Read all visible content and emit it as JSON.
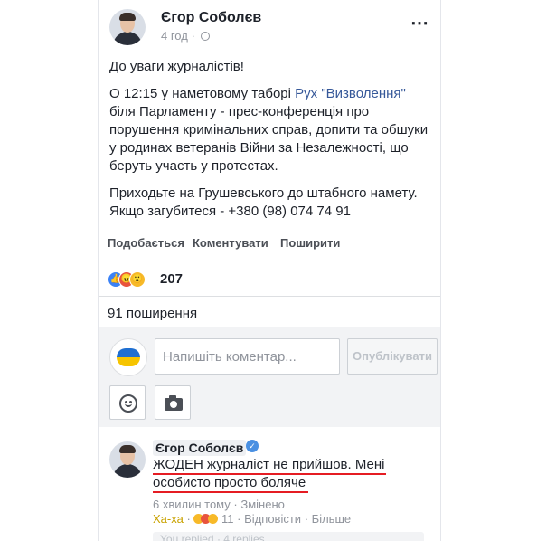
{
  "post": {
    "author": "Єгор Соболєв",
    "time": "4 год",
    "time_separator": "·",
    "paragraph1": "До уваги журналістів!",
    "paragraph2_before": "О 12:15 у наметовому таборі ",
    "paragraph2_link": "Рух \"Визволення\"",
    "paragraph2_after": " біля Парламенту - прес-конференція про порушення кримінальних справ, допити та обшуки у родинах ветеранів Війни за Незалежності, що беруть участь у протестах.",
    "paragraph3": "Приходьте на Грушевського до штабного намету. Якщо загубитеся - +380 (98) 074 74 91",
    "more_icon": "⋯"
  },
  "actions": {
    "like": "Подобається",
    "comment": "Коментувати",
    "share": "Поширити"
  },
  "reactions": {
    "count": "207",
    "icons": [
      "like-icon",
      "angry-icon",
      "wow-icon"
    ],
    "like_glyph": "👍",
    "angry_glyph": "😠",
    "wow_glyph": "😮"
  },
  "shares_text": "91 поширення",
  "comment_box": {
    "placeholder": "Напишіть коментар...",
    "publish_label": "Опублікувати"
  },
  "comment": {
    "author": "Єгор Соболєв",
    "verified_glyph": "✓",
    "text": "ЖОДЕН журналіст не прийшов. Мені особисто просто боляче",
    "time": "6 хвилин тому",
    "dot": "·",
    "edited": "Змінено",
    "haha_label": "Ха-ха",
    "reaction_count": "11",
    "reply": "Відповісти",
    "more": "Більше",
    "replies_stub": "You replied · 4 replies"
  },
  "colors": {
    "link": "#365899",
    "underline": "#e51c23",
    "haha": "#c9a200",
    "verified": "#4a90e2"
  }
}
